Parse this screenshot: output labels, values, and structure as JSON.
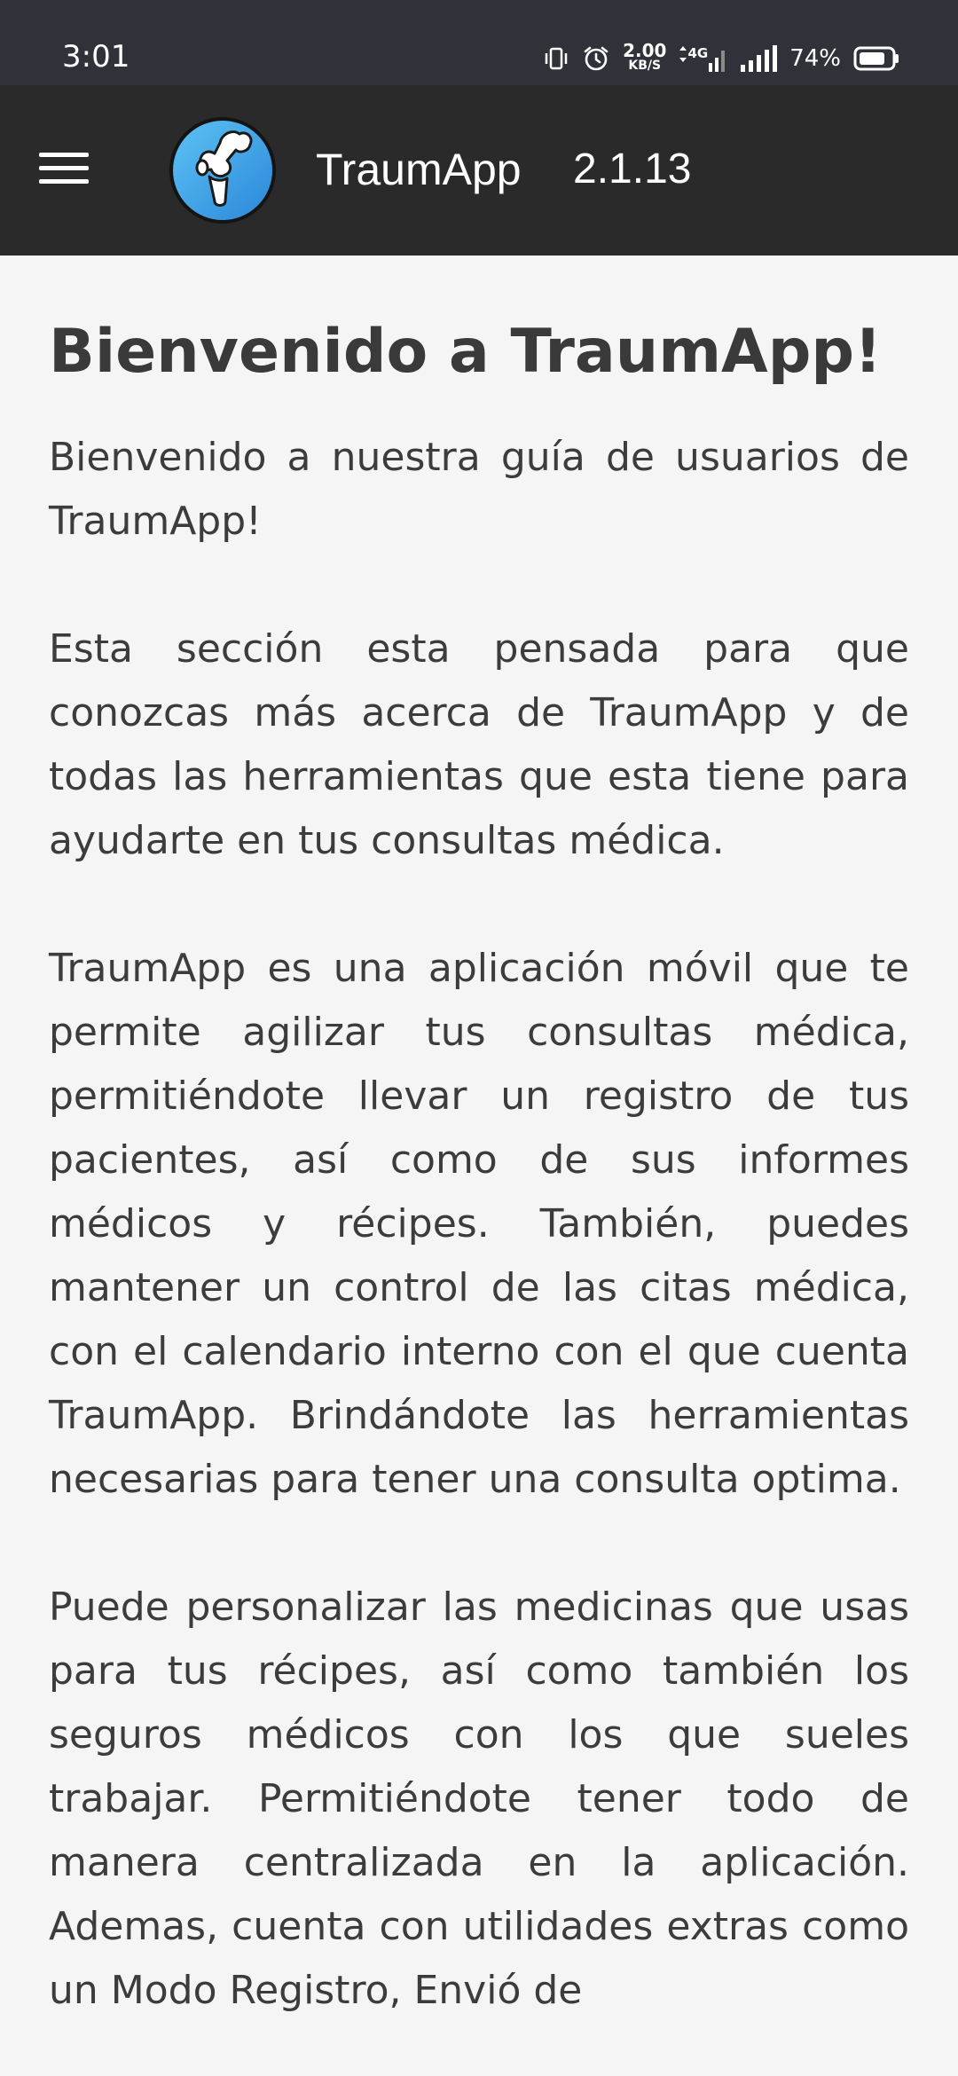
{
  "status_bar": {
    "time": "3:01",
    "net_speed_value": "2.00",
    "net_speed_unit": "KB/S",
    "network_type": "4G",
    "battery_percent": "74%",
    "icons": [
      "vibrate-icon",
      "alarm-icon",
      "data-arrows-icon",
      "signal-icon",
      "battery-icon"
    ]
  },
  "app_bar": {
    "title": "TraumApp",
    "version": "2.1.13",
    "background": "#2a2a2a",
    "logo_color": "#3aa0e8"
  },
  "main": {
    "title": "Bienvenido a TraumApp!",
    "paragraphs": [
      "Bienvenido a nuestra guía de usuarios de TraumApp!",
      "Esta sección esta pensada para que conozcas más acerca de TraumApp y de todas las herramientas que esta tiene para ayudarte en tus consultas médica.",
      "TraumApp es una aplicación móvil que te permite agilizar tus consultas médica, permitiéndote llevar un registro de tus pacientes, así como de sus informes médicos y récipes. También, puedes mantener un control de las citas médica, con el calendario interno con el que cuenta TraumApp. Brindándote las herramientas necesarias para tener una consulta optima.",
      "Puede personalizar las medicinas que usas para tus récipes, así como también los seguros médicos con los que sueles trabajar. Permitiéndote tener todo de manera centralizada en la aplicación. Ademas, cuenta con utilidades extras como un Modo Registro, Envió de"
    ]
  }
}
